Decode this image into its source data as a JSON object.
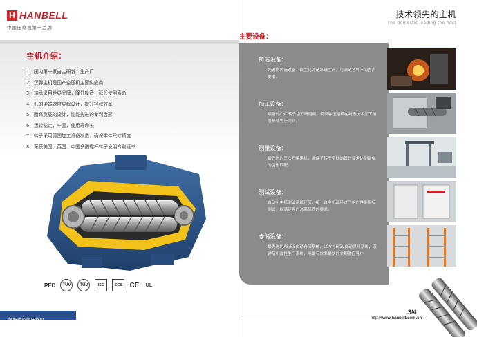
{
  "brand": {
    "name": "HANBELL",
    "tagline": "中国压缩机第一品牌"
  },
  "intro": {
    "title": "主机介绍：",
    "features": [
      "1、国内第一家自主研发、生产厂",
      "2、汉钟主机是国产空压机主要供应商",
      "3、轴承采用世界品牌，降低噪音，延长使用寿命",
      "4、低的尖端速度导程设计，提升容积效率",
      "5、耐高负载的设计，性能先进的专利齿形",
      "6、运转稳定，牢固，使用寿命长",
      "7、转子采用德国加工设备制造，确保零件尺寸精度",
      "8、荣获美国、英国、中国多国螺杆转子发明专利证书"
    ]
  },
  "certifications": [
    "PED",
    "TÜV",
    "TÜV",
    "ISO",
    "SGS",
    "CE",
    "UL"
  ],
  "left_footer": "螺杆式空气压缩机",
  "right": {
    "title": "技术领先的主机",
    "subtitle": "The domestic leading the host",
    "section_title": "主要设备：",
    "equipment": [
      {
        "heading": "铸造设备：",
        "desc": "先进的铸造设备，自主化铸造系统生产，可满足各种不同客户要求。"
      },
      {
        "heading": "加工设备：",
        "desc": "最新的CNC转子齿形研磨机，使汉钟压缩机在制造技术加工精度都领先于同业。"
      },
      {
        "heading": "测量设备：",
        "desc": "最先进的三次元量床机，确保了转子型线的设计要求达到最优的齿形匹配。"
      },
      {
        "heading": "测试设备：",
        "desc": "自动化主机测试系统环节，每一台主机都经过严格的性能指标测试，以满足客户对高品质的要求。"
      },
      {
        "heading": "仓储设备：",
        "desc": "最先进的AS/RS自动仓储系统，LGV与HGV自动供料系统，汉钟精机弹性生产系统，用最有效率最快的交期供应客户"
      }
    ],
    "page_number": "3/4",
    "website_prefix": "http://",
    "website_domain": "www.hanbell.com.cn"
  },
  "colors": {
    "brand_red": "#c8242a",
    "panel_gray": "#8b8b8b",
    "footer_blue": "#2a4f8f",
    "casing_blue": "#2f5a8c",
    "casing_yellow": "#f2c21a"
  }
}
